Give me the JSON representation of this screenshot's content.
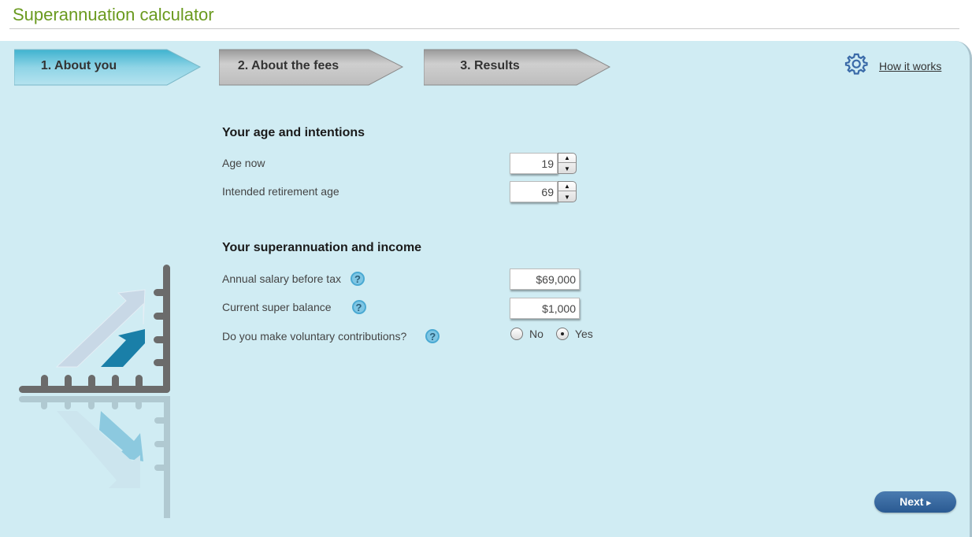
{
  "page": {
    "title": "Superannuation calculator"
  },
  "steps": [
    {
      "label": "1. About you",
      "active": true
    },
    {
      "label": "2. About the fees",
      "active": false
    },
    {
      "label": "3. Results",
      "active": false
    }
  ],
  "help_link": {
    "icon": "gear-icon",
    "label": "How it works"
  },
  "sections": {
    "age": {
      "heading": "Your age and intentions",
      "age_now_label": "Age now",
      "age_now_value": "19",
      "retirement_label": "Intended retirement age",
      "retirement_value": "69"
    },
    "income": {
      "heading": "Your superannuation and income",
      "salary_label": "Annual salary before tax",
      "salary_value": "$69,000",
      "balance_label": "Current super balance",
      "balance_value": "$1,000",
      "voluntary_label": "Do you make voluntary contributions?",
      "help_glyph": "?",
      "options": [
        {
          "label": "No",
          "selected": false
        },
        {
          "label": "Yes",
          "selected": true
        }
      ]
    }
  },
  "footer": {
    "next_label": "Next",
    "next_arrow": "▸"
  },
  "colors": {
    "title": "#6a9a1f",
    "panel": "#d0ecf3",
    "active_step": "#5cbfd8",
    "inactive_step": "#b8b8b8",
    "next_button": "#2a5a92",
    "chart_arrow_dark": "#1a7fa8",
    "chart_arrow_light": "#c8d8e6",
    "chart_axis": "#6b6b6b"
  }
}
